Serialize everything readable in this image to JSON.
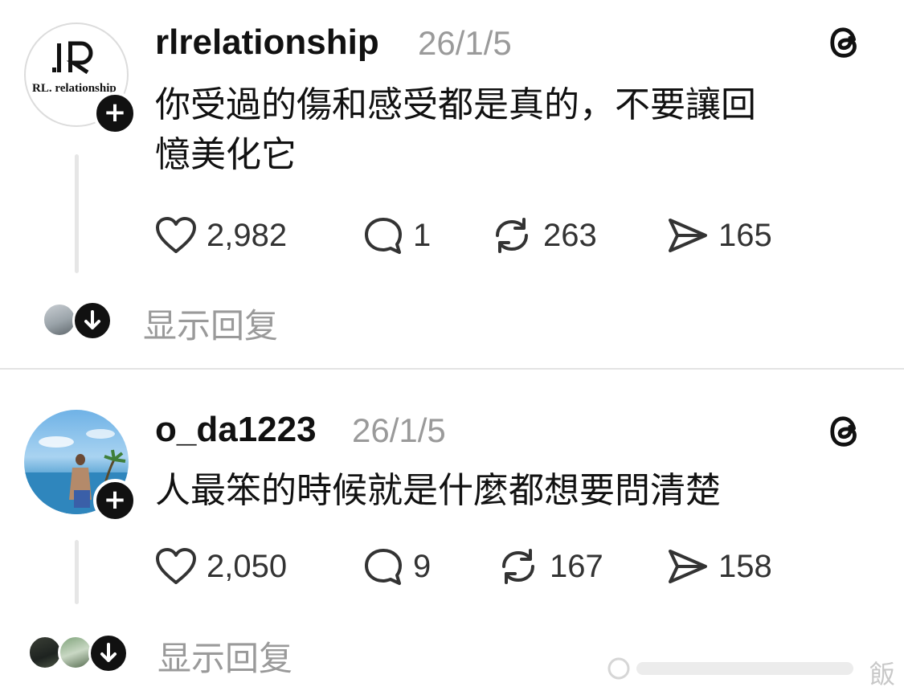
{
  "posts": [
    {
      "avatar": {
        "kind": "logo",
        "mark": "RL",
        "text": "RL. relationship"
      },
      "username": "rlrelationship",
      "date": "26/1/5",
      "text": "你受過的傷和感受都是真的，不要讓回\n憶美化它",
      "likes": "2,982",
      "comments": "1",
      "reposts": "263",
      "shares": "165",
      "show_replies": "显示回复"
    },
    {
      "avatar": {
        "kind": "photo"
      },
      "username": "o_da1223",
      "date": "26/1/5",
      "text": "人最笨的時候就是什麼都想要問清楚",
      "likes": "2,050",
      "comments": "9",
      "reposts": "167",
      "shares": "158",
      "show_replies": "显示回复"
    }
  ],
  "icons": {
    "follow": "plus-icon",
    "platform": "threads-icon",
    "like": "heart-icon",
    "comment": "comment-icon",
    "repost": "repost-icon",
    "share": "share-icon",
    "expand": "arrow-down-icon"
  },
  "colors": {
    "text": "#111111",
    "muted": "#9a9a9a",
    "divider": "#e3e3e3"
  },
  "watermark": "飯"
}
